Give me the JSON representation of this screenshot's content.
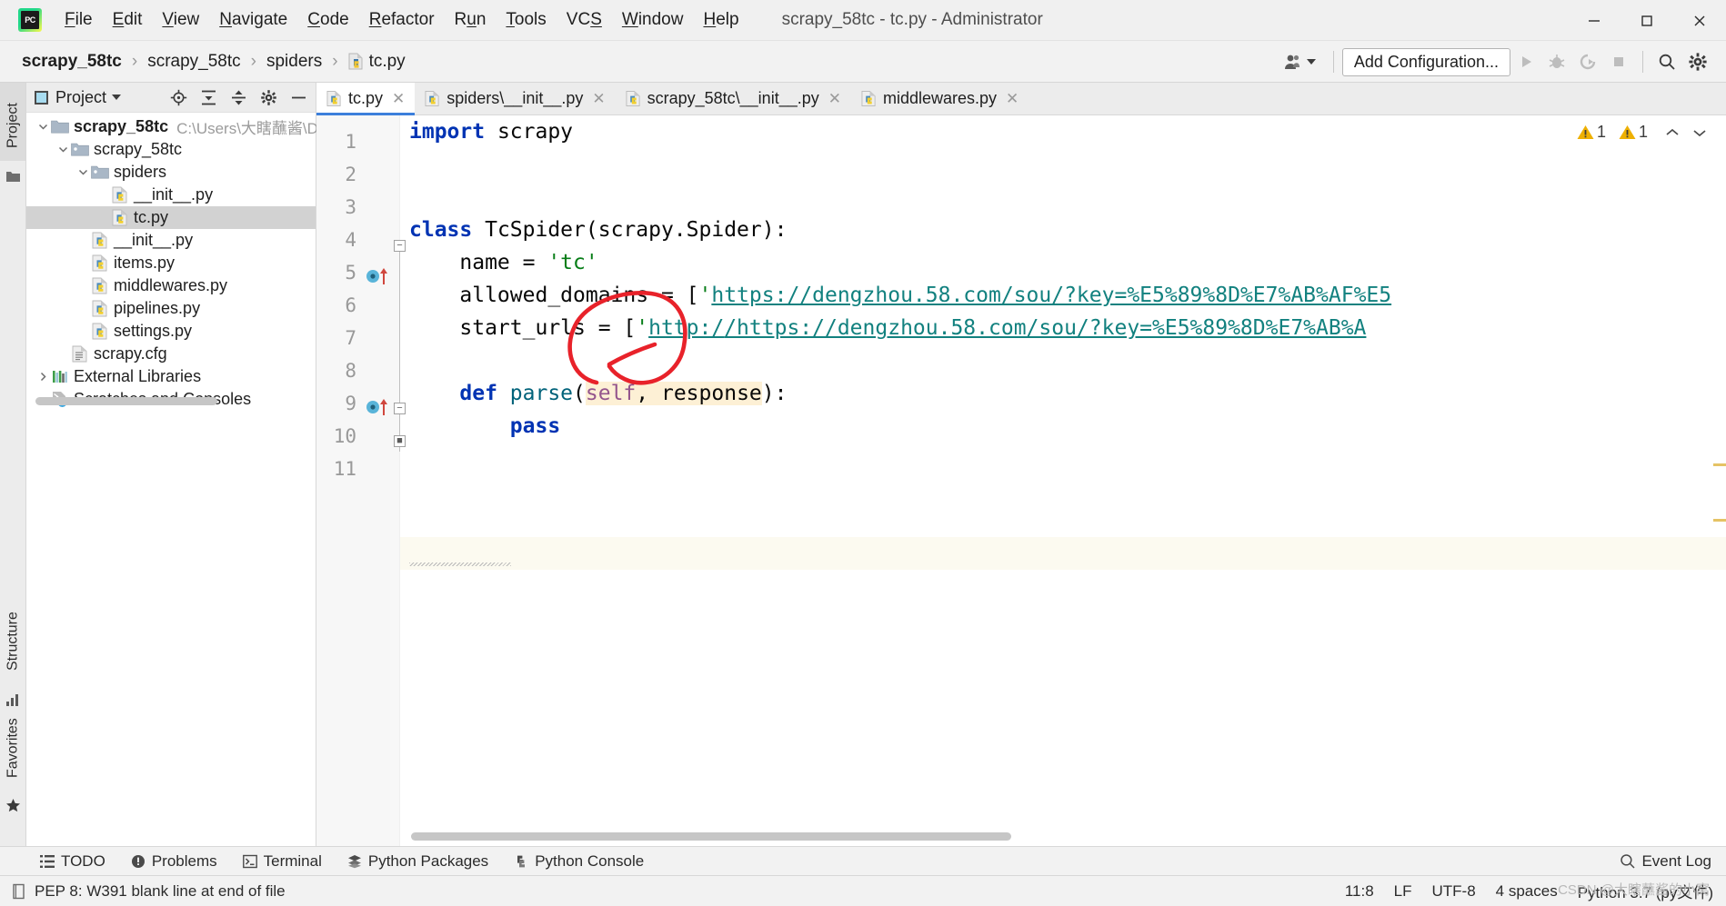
{
  "window": {
    "title": "scrapy_58tc - tc.py - Administrator",
    "app_logo": "pycharm-logo",
    "minimize": "minimize-icon",
    "maximize": "maximize-icon",
    "close": "close-icon"
  },
  "menu": {
    "items": [
      {
        "label": "File",
        "mnemonic": "F"
      },
      {
        "label": "Edit",
        "mnemonic": "E"
      },
      {
        "label": "View",
        "mnemonic": "V"
      },
      {
        "label": "Navigate",
        "mnemonic": "N"
      },
      {
        "label": "Code",
        "mnemonic": "C"
      },
      {
        "label": "Refactor",
        "mnemonic": "R"
      },
      {
        "label": "Run",
        "mnemonic": "u"
      },
      {
        "label": "Tools",
        "mnemonic": "T"
      },
      {
        "label": "VCS",
        "mnemonic": "S"
      },
      {
        "label": "Window",
        "mnemonic": "W"
      },
      {
        "label": "Help",
        "mnemonic": "H"
      }
    ]
  },
  "navbar": {
    "breadcrumbs": [
      "scrapy_58tc",
      "scrapy_58tc",
      "spiders",
      "tc.py"
    ],
    "separator": "›",
    "add_configuration": "Add Configuration...",
    "run_icon": "run-icon",
    "debug_icon": "debug-icon",
    "coverage_icon": "run-with-coverage-icon",
    "stop_icon": "stop-icon",
    "search_icon": "search-everywhere-icon",
    "settings_icon": "settings-gear-icon",
    "user_icon": "user-account-icon"
  },
  "stripes": {
    "project": "Project",
    "structure": "Structure",
    "favorites": "Favorites"
  },
  "project_panel": {
    "title": "Project",
    "tools": [
      "locate-icon",
      "expand-all-icon",
      "collapse-all-icon",
      "gear-icon",
      "hide-icon"
    ],
    "tree": [
      {
        "label": "scrapy_58tc",
        "path": "C:\\Users\\大瞎蘸酱\\Deskto",
        "indent": 0,
        "arrow": "down",
        "icon": "folder-icon",
        "bold": true,
        "selected": false
      },
      {
        "label": "scrapy_58tc",
        "path": "",
        "indent": 1,
        "arrow": "down",
        "icon": "source-folder-icon",
        "bold": false,
        "selected": false
      },
      {
        "label": "spiders",
        "path": "",
        "indent": 2,
        "arrow": "down",
        "icon": "source-folder-icon",
        "bold": false,
        "selected": false
      },
      {
        "label": "__init__.py",
        "path": "",
        "indent": 3,
        "arrow": "none",
        "icon": "python-file-icon",
        "bold": false,
        "selected": false
      },
      {
        "label": "tc.py",
        "path": "",
        "indent": 3,
        "arrow": "none",
        "icon": "python-file-icon",
        "bold": false,
        "selected": true
      },
      {
        "label": "__init__.py",
        "path": "",
        "indent": 2,
        "arrow": "none",
        "icon": "python-file-icon",
        "bold": false,
        "selected": false
      },
      {
        "label": "items.py",
        "path": "",
        "indent": 2,
        "arrow": "none",
        "icon": "python-file-icon",
        "bold": false,
        "selected": false
      },
      {
        "label": "middlewares.py",
        "path": "",
        "indent": 2,
        "arrow": "none",
        "icon": "python-file-icon",
        "bold": false,
        "selected": false
      },
      {
        "label": "pipelines.py",
        "path": "",
        "indent": 2,
        "arrow": "none",
        "icon": "python-file-icon",
        "bold": false,
        "selected": false
      },
      {
        "label": "settings.py",
        "path": "",
        "indent": 2,
        "arrow": "none",
        "icon": "python-file-icon",
        "bold": false,
        "selected": false
      },
      {
        "label": "scrapy.cfg",
        "path": "",
        "indent": 1,
        "arrow": "none",
        "icon": "config-file-icon",
        "bold": false,
        "selected": false
      },
      {
        "label": "External Libraries",
        "path": "",
        "indent": 0,
        "arrow": "right",
        "icon": "libraries-icon",
        "bold": false,
        "selected": false
      },
      {
        "label": "Scratches and Consoles",
        "path": "",
        "indent": 0,
        "arrow": "none",
        "icon": "scratches-icon",
        "bold": false,
        "selected": false
      }
    ]
  },
  "editor": {
    "tabs": [
      {
        "label": "tc.py",
        "icon": "python-file-icon",
        "active": true
      },
      {
        "label": "spiders\\__init__.py",
        "icon": "python-file-icon",
        "active": false
      },
      {
        "label": "scrapy_58tc\\__init__.py",
        "icon": "python-file-icon",
        "active": false
      },
      {
        "label": "middlewares.py",
        "icon": "python-file-icon",
        "active": false
      }
    ],
    "line_numbers": [
      "1",
      "2",
      "3",
      "4",
      "5",
      "6",
      "7",
      "8",
      "9",
      "10",
      "11"
    ],
    "current_line": 11,
    "inspection": {
      "warning_count_1": "1",
      "warning_count_2": "1",
      "up_icon": "chevron-up-icon",
      "down_icon": "chevron-down-icon"
    },
    "code": {
      "line1_kw": "import",
      "line1_mod": " scrapy",
      "line4_kw": "class",
      "line4_rest": " TcSpider(scrapy.Spider):",
      "line5_name": "    name = ",
      "line5_val": "'tc'",
      "line6_lhs": "    allowed_domains = [",
      "line6_quote": "'",
      "line6_url": "https://dengzhou.58.com/sou/?key=%E5%89%8D%E7%AB%AF%E5",
      "line7_lhs": "    start_urls = [",
      "line7_quote": "'",
      "line7_url_a": "http:/",
      "line7_url_b": "/https://dengzhou.58.com/sou/?key=%E5%89%8D%E7%AB%A",
      "line9_kw": "    def ",
      "line9_fn": "parse",
      "line9_open": "(",
      "line9_self": "self",
      "line9_comma": ", ",
      "line9_resp": "response",
      "line9_close": "):",
      "line10_pass": "        pass"
    },
    "annotation": "red-circle-annotation"
  },
  "tool_window_bar": {
    "items": [
      {
        "label": "TODO",
        "icon": "todo-icon"
      },
      {
        "label": "Problems",
        "icon": "problems-icon"
      },
      {
        "label": "Terminal",
        "icon": "terminal-icon"
      },
      {
        "label": "Python Packages",
        "icon": "python-packages-icon"
      },
      {
        "label": "Python Console",
        "icon": "python-console-icon"
      }
    ],
    "event_log": "Event Log",
    "event_log_icon": "event-log-icon"
  },
  "status_bar": {
    "message": "PEP 8: W391 blank line at end of file",
    "message_icon": "inspection-icon",
    "caret": "11:8",
    "line_separator": "LF",
    "encoding": "UTF-8",
    "indent": "4 spaces",
    "interpreter": "Python 3.7 (py文件)"
  },
  "watermark": "CSDN @大瞎蘸酱的小窝",
  "colors": {
    "accent_blue": "#3c7fdb",
    "keyword_blue": "#0033b3",
    "string_green": "#067d17",
    "url_teal": "#12817f",
    "annotation_red": "#e8222a",
    "warning_yellow": "#eeb003",
    "selection_gray": "#d2d2d2"
  }
}
